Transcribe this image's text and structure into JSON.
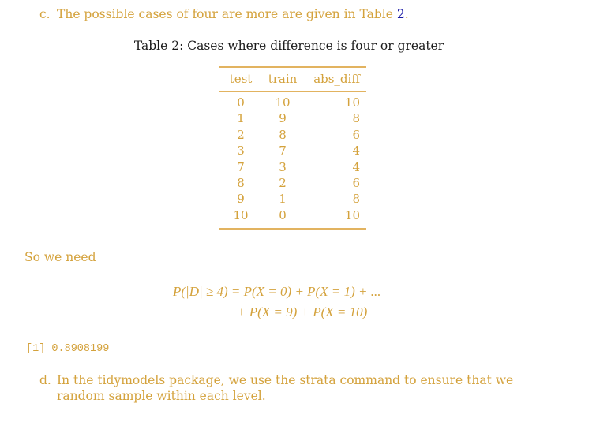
{
  "item_c": {
    "marker": "c.",
    "text": "The possible cases of four are more are given in Table ",
    "table_ref": "2",
    "end": "."
  },
  "table": {
    "caption": "Table 2: Cases where difference is four or greater",
    "headers": [
      "test",
      "train",
      "abs_diff"
    ],
    "rows": [
      [
        "0",
        "10",
        "10"
      ],
      [
        "1",
        "9",
        "8"
      ],
      [
        "2",
        "8",
        "6"
      ],
      [
        "3",
        "7",
        "4"
      ],
      [
        "7",
        "3",
        "4"
      ],
      [
        "8",
        "2",
        "6"
      ],
      [
        "9",
        "1",
        "8"
      ],
      [
        "10",
        "0",
        "10"
      ]
    ]
  },
  "so_we_need": "So we need",
  "equation": {
    "line1": "P(|D| ≥ 4) = P(X = 0) + P(X = 1) + ...",
    "line2": "+ P(X = 9) + P(X = 10)"
  },
  "r_output": "[1] 0.8908199",
  "item_d": {
    "marker": "d.",
    "text": "In the tidymodels package, we use the strata command to ensure that we random sample within each level."
  },
  "colors": {
    "text_accent": "#d4a23c",
    "rule": "#e2b360",
    "link": "#1a1aa6",
    "caption": "#1a1a1a"
  }
}
